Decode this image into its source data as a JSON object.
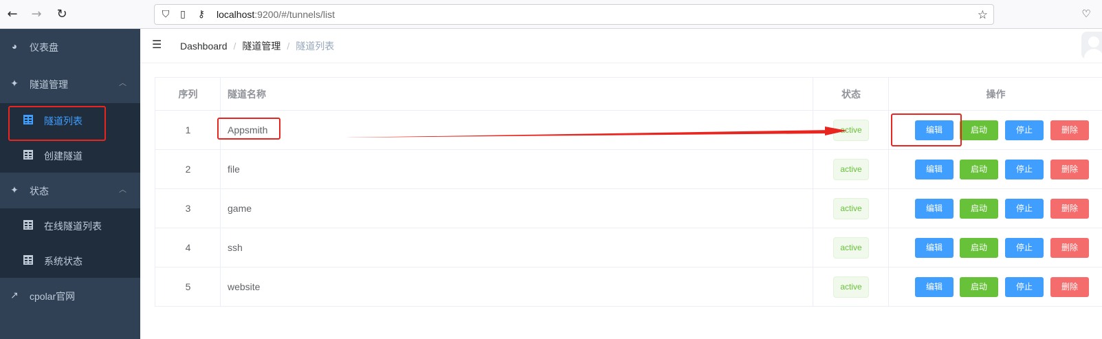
{
  "browser": {
    "url_host": "localhost",
    "url_rest": ":9200/#/tunnels/list"
  },
  "sidebar": {
    "items": [
      {
        "label": "仪表盘"
      },
      {
        "label": "隧道管理"
      },
      {
        "label": "隧道列表"
      },
      {
        "label": "创建隧道"
      },
      {
        "label": "状态"
      },
      {
        "label": "在线隧道列表"
      },
      {
        "label": "系统状态"
      },
      {
        "label": "cpolar官网"
      }
    ]
  },
  "breadcrumb": {
    "items": [
      "Dashboard",
      "隧道管理",
      "隧道列表"
    ]
  },
  "table": {
    "headers": {
      "index": "序列",
      "name": "隧道名称",
      "status": "状态",
      "ops": "操作"
    },
    "buttons": {
      "edit": "编辑",
      "start": "启动",
      "stop": "停止",
      "delete": "删除"
    },
    "rows": [
      {
        "index": "1",
        "name": "Appsmith",
        "status": "active"
      },
      {
        "index": "2",
        "name": "file",
        "status": "active"
      },
      {
        "index": "3",
        "name": "game",
        "status": "active"
      },
      {
        "index": "4",
        "name": "ssh",
        "status": "active"
      },
      {
        "index": "5",
        "name": "website",
        "status": "active"
      }
    ]
  },
  "colors": {
    "sidebar_bg": "#304156",
    "submenu_bg": "#1f2d3d",
    "primary": "#409eff",
    "success": "#67c23a",
    "danger": "#f56c6c",
    "annotation": "#e8251f"
  }
}
